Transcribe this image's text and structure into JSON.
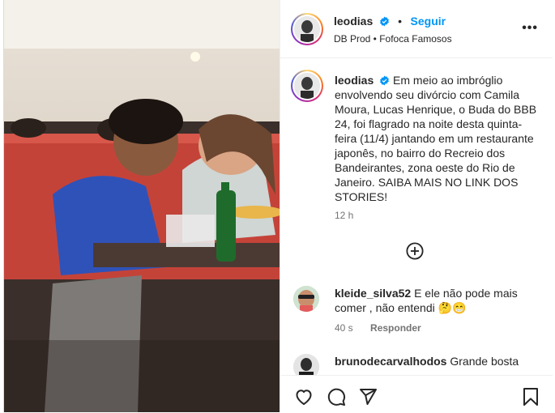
{
  "post": {
    "username": "leodias",
    "follow_label": "Seguir",
    "separator": "•",
    "location": "DB Prod • Fofoca Famosos",
    "more_label": "•••",
    "caption_username": "leodias",
    "caption_text": "Em meio ao imbróglio envolvendo seu divórcio com Camila Moura, Lucas Henrique, o Buda do BBB 24, foi flagrado na noite desta quinta-feira (11/4) jantando em um restaurante japonês, no bairro do Recreio dos Bandeirantes, zona oeste do Rio de Janeiro. SAIBA MAIS NO LINK DOS STORIES!",
    "time_ago": "12 h"
  },
  "comments": [
    {
      "username": "kleide_silva52",
      "text": "E ele não pode mais comer , não entendi 🤔😁",
      "time": "40 s",
      "reply_label": "Responder"
    },
    {
      "username": "brunodecarvalhodos",
      "text": "Grande bosta"
    }
  ],
  "icons": {
    "like": "heart-icon",
    "comment": "comment-bubble-icon",
    "share": "paper-plane-icon",
    "save": "bookmark-icon",
    "verified": "verified-badge-icon",
    "load_more": "plus-circle-icon"
  },
  "colors": {
    "accent": "#0095f6",
    "text": "#262626",
    "muted": "#737373",
    "verified": "#0095f6"
  }
}
